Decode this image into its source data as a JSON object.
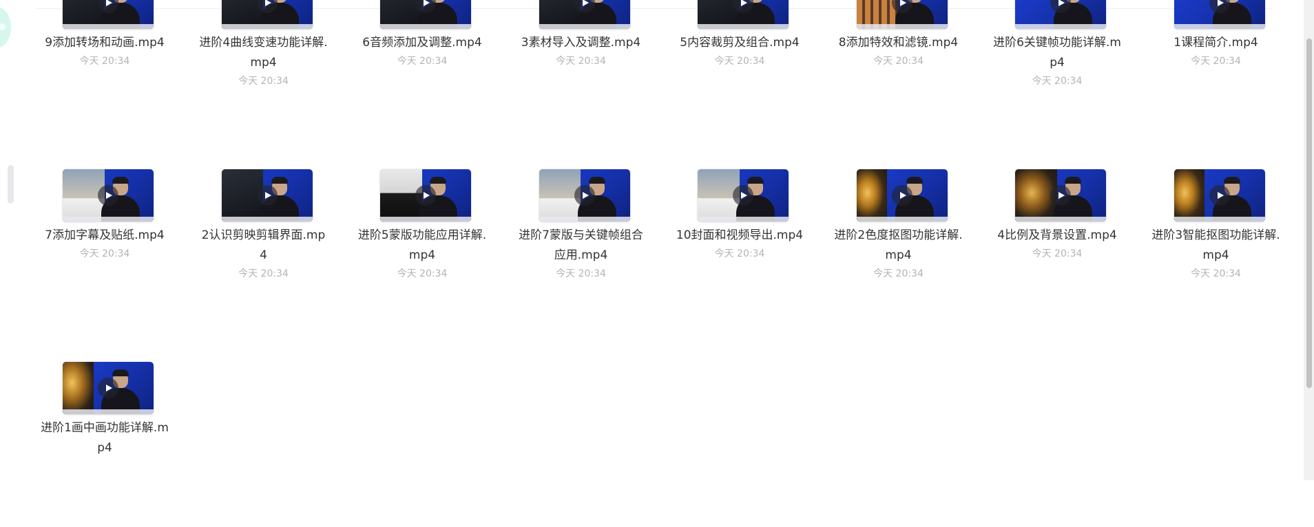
{
  "files": [
    {
      "name": "9添加转场和动画.mp4",
      "time": "今天 20:34",
      "thumb_style": "dark-ui"
    },
    {
      "name": "进阶4曲线变速功能详解.mp4",
      "time": "今天 20:34",
      "thumb_style": "dark-ui"
    },
    {
      "name": "6音频添加及调整.mp4",
      "time": "今天 20:34",
      "thumb_style": "dark-ui"
    },
    {
      "name": "3素材导入及调整.mp4",
      "time": "今天 20:34",
      "thumb_style": "dark-ui"
    },
    {
      "name": "5内容裁剪及组合.mp4",
      "time": "今天 20:34",
      "thumb_style": "dark-ui"
    },
    {
      "name": "8添加特效和滤镜.mp4",
      "time": "今天 20:34",
      "thumb_style": "effects"
    },
    {
      "name": "进阶6关键帧功能详解.mp4",
      "time": "今天 20:34",
      "thumb_style": "studio"
    },
    {
      "name": "1课程简介.mp4",
      "time": "今天 20:34",
      "thumb_style": "studio"
    },
    {
      "name": "7添加字幕及贴纸.mp4",
      "time": "今天 20:34",
      "thumb_style": "photo-ui"
    },
    {
      "name": "2认识剪映剪辑界面.mp4",
      "time": "今天 20:34",
      "thumb_style": "dark-ui"
    },
    {
      "name": "进阶5蒙版功能应用详解.mp4",
      "time": "今天 20:34",
      "thumb_style": "mask-ui"
    },
    {
      "name": "进阶7蒙版与关键帧组合应用.mp4",
      "time": "今天 20:34",
      "thumb_style": "photo-ui"
    },
    {
      "name": "10封面和视频导出.mp4",
      "time": "今天 20:34",
      "thumb_style": "photo-ui"
    },
    {
      "name": "进阶2色度抠图功能详解.mp4",
      "time": "今天 20:34",
      "thumb_style": "gold"
    },
    {
      "name": "4比例及背景设置.mp4",
      "time": "今天 20:34",
      "thumb_style": "gold-dark"
    },
    {
      "name": "进阶3智能抠图功能详解.mp4",
      "time": "今天 20:34",
      "thumb_style": "gold"
    },
    {
      "name": "进阶1画中画功能详解.mp4",
      "time": "",
      "thumb_style": "gold-full"
    }
  ],
  "colors": {
    "studio_blue": "#1c3fd6",
    "text": "#333333",
    "time_text": "#b3b3b3"
  },
  "icons": {
    "play": "play-icon"
  }
}
